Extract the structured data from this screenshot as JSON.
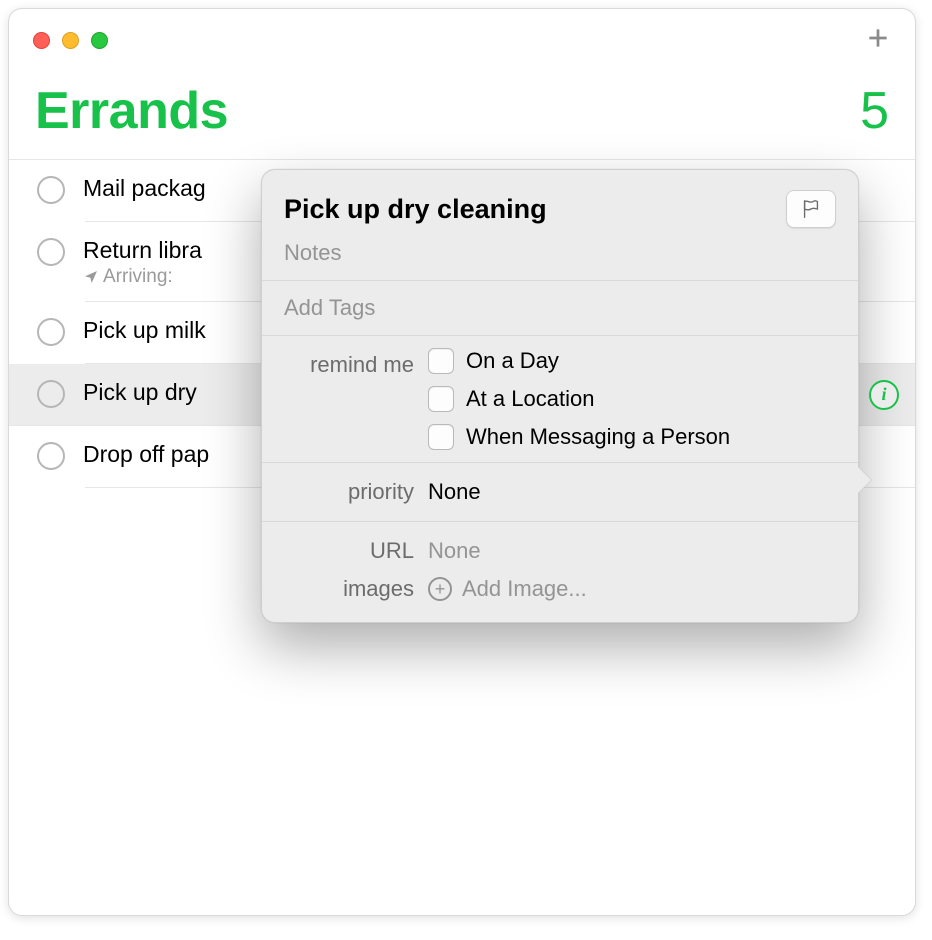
{
  "header": {
    "title": "Errands",
    "count": "5"
  },
  "reminders": [
    {
      "title": "Mail packag",
      "sub": null
    },
    {
      "title": "Return libra",
      "sub": "Arriving:"
    },
    {
      "title": "Pick up milk",
      "sub": null
    },
    {
      "title": "Pick up dry",
      "sub": null
    },
    {
      "title": "Drop off pap",
      "sub": null
    }
  ],
  "popover": {
    "title": "Pick up dry cleaning",
    "notes_placeholder": "Notes",
    "tags_placeholder": "Add Tags",
    "remind_label": "remind me",
    "options": {
      "day": "On a Day",
      "location": "At a Location",
      "messaging": "When Messaging a Person"
    },
    "priority_label": "priority",
    "priority_value": "None",
    "url_label": "URL",
    "url_value": "None",
    "images_label": "images",
    "add_image_label": "Add Image..."
  }
}
